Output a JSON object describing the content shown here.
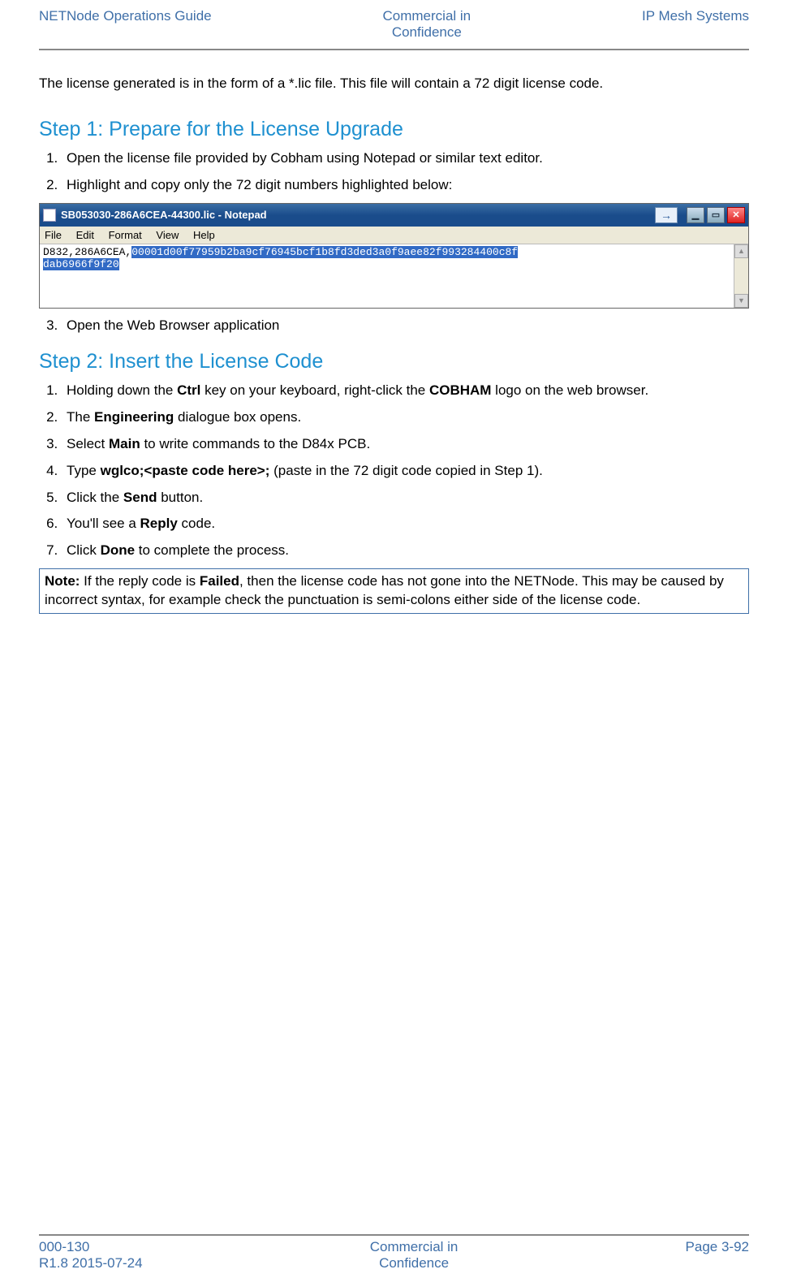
{
  "header": {
    "left": "NETNode Operations Guide",
    "center1": "Commercial in",
    "center2": "Confidence",
    "right": "IP Mesh Systems"
  },
  "intro": "The license generated is in the form of a *.lic file. This file will contain a 72 digit license code.",
  "step1": {
    "title": "Step 1: Prepare for the License Upgrade",
    "items": [
      "Open the license file provided by Cobham using Notepad or similar text editor.",
      "Highlight and copy only the 72 digit numbers highlighted below:"
    ],
    "item3": "Open the Web Browser application"
  },
  "notepad": {
    "title": "SB053030-286A6CEA-44300.lic - Notepad",
    "menus": {
      "file": "File",
      "edit": "Edit",
      "format": "Format",
      "view": "View",
      "help": "Help"
    },
    "plain": "D832,286A6CEA,",
    "selected1": "00001d00f77959b2ba9cf76945bcf1b8fd3ded3a0f9aee82f993284400c8f",
    "selected2": "dab6966f9f20",
    "arrow_glyph": "→",
    "min_glyph": "▁",
    "max_glyph": "▭",
    "close_glyph": "✕",
    "scroll_up_glyph": "▲",
    "scroll_down_glyph": "▼"
  },
  "step2": {
    "title": "Step 2: Insert the License Code",
    "i1a": "Holding down the ",
    "i1b": "Ctrl",
    "i1c": " key on your keyboard, right-click the ",
    "i1d": "COBHAM",
    "i1e": " logo on the web browser.",
    "i2a": "The ",
    "i2b": "Engineering",
    "i2c": " dialogue box opens.",
    "i3a": "Select ",
    "i3b": "Main",
    "i3c": " to write commands to the D84x PCB.",
    "i4a": "Type ",
    "i4b": "wglco;<paste code here>;",
    "i4c": " (paste in the 72 digit code copied in Step 1).",
    "i5a": "Click the ",
    "i5b": "Send",
    "i5c": " button.",
    "i6a": "You'll see a ",
    "i6b": "Reply",
    "i6c": " code.",
    "i7a": "Click ",
    "i7b": "Done",
    "i7c": " to complete the process."
  },
  "note": {
    "label": "Note:",
    "t1": " If the reply code is ",
    "t2": "Failed",
    "t3": ", then the license code has not gone into the NETNode. This may be caused by incorrect syntax, for example check the punctuation is semi-colons either side of the license code."
  },
  "footer": {
    "left1": "000-130",
    "left2": "R1.8 2015-07-24",
    "center1": "Commercial in",
    "center2": "Confidence",
    "right": "Page 3-92"
  }
}
